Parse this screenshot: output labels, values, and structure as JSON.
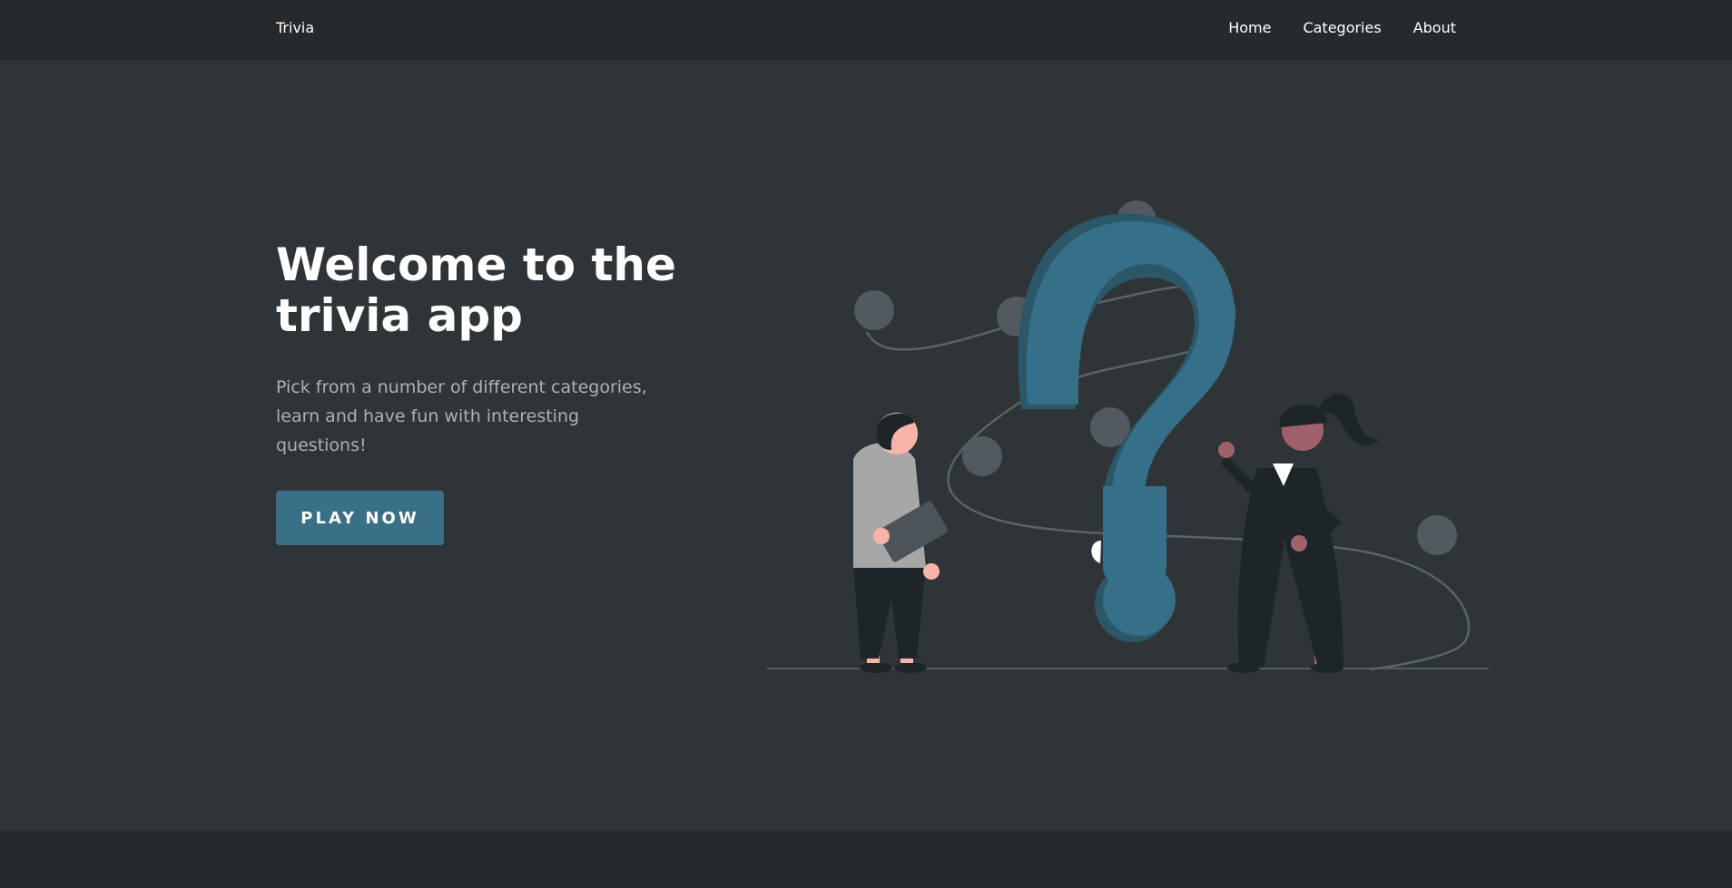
{
  "nav": {
    "brand": "Trivia",
    "links": [
      "Home",
      "Categories",
      "About"
    ]
  },
  "hero": {
    "title": "Welcome to the trivia app",
    "description": "Pick from a number of different categories, learn and have fun with interesting questions!",
    "cta_label": "PLAY NOW"
  },
  "colors": {
    "background": "#2f3537",
    "navbar": "#262a2d",
    "accent": "#3a7087",
    "text_muted": "#aab0b4"
  }
}
